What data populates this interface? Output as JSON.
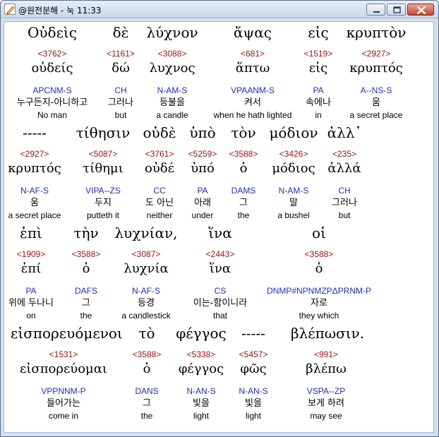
{
  "window": {
    "title": "@원전분해 - 눅 11:33",
    "app_icon": "bible-app-icon",
    "minimize_icon": "minimize-icon",
    "maximize_icon": "maximize-icon",
    "close_icon": "close-icon"
  },
  "colors": {
    "strong": "#9b1111",
    "parse": "#1f2fb8",
    "text": "#000000",
    "selection": "#e9e9e9"
  },
  "words": [
    {
      "greek": "Οὐδεὶς",
      "strong": "<3762>",
      "lemma": "οὐδείς",
      "parse": "APCNM-S",
      "korean": "누구든지-아니하고",
      "english": "No man"
    },
    {
      "greek": "δὲ",
      "strong": "<1161>",
      "lemma": "δώ",
      "parse": "CH",
      "korean": "그러나",
      "english": "but"
    },
    {
      "greek": "λύχνον",
      "strong": "<3088>",
      "lemma": "λυχνος",
      "parse": "N-AM-S",
      "korean": "등불을",
      "english": "a candle"
    },
    {
      "greek": "ἅψας",
      "strong": "<681>",
      "lemma": "ἅπτω",
      "parse": "VPAANM-S",
      "korean": "켜서",
      "english": "when he hath lighted"
    },
    {
      "greek": "εἰς",
      "strong": "<1519>",
      "lemma": "εἰς",
      "parse": "PA",
      "korean": "속에나",
      "english": "in"
    },
    {
      "greek": "κρυπτὸν",
      "strong": "<2927>",
      "lemma": "κρυπτός",
      "parse": "A--NS-S",
      "korean": "움",
      "english": "a secret place"
    },
    {
      "greek": "-----",
      "strong": "<2927>",
      "lemma": "κρυπτός",
      "parse": "N-AF-S",
      "korean": "움",
      "english": "a secret place"
    },
    {
      "greek": "τίθησιν",
      "strong": "<5087>",
      "lemma": "τίθημι",
      "parse": "VIPA--ZS",
      "korean": "두지",
      "english": "putteth it"
    },
    {
      "greek": "οὐδὲ",
      "strong": "<3761>",
      "lemma": "οὐδέ",
      "parse": "CC",
      "korean": "도 아닌",
      "english": "neither"
    },
    {
      "greek": "ὑπὸ",
      "strong": "<5259>",
      "lemma": "ὑπό",
      "parse": "PA",
      "korean": "아래",
      "english": "under"
    },
    {
      "greek": "τὸν",
      "strong": "<3588>",
      "lemma": "ὁ",
      "parse": "DAMS",
      "korean": "그",
      "english": "the"
    },
    {
      "greek": "μόδιον",
      "strong": "<3426>",
      "lemma": "μόδιος",
      "parse": "N-AM-S",
      "korean": "말",
      "english": "a bushel"
    },
    {
      "greek": "ἀλλ᾽",
      "strong": "<235>",
      "lemma": "ἀλλά",
      "parse": "CH",
      "korean": "그러나",
      "english": "but"
    },
    {
      "greek": "ἐπὶ",
      "strong": "<1909>",
      "lemma": "ἐπί",
      "parse": "PA",
      "korean": "위에 두나니",
      "english": "on"
    },
    {
      "greek": "τὴν",
      "strong": "<3588>",
      "lemma": "ὁ",
      "parse": "DAFS",
      "korean": "그",
      "english": "the"
    },
    {
      "greek": "λυχνίαν,",
      "strong": "<3087>",
      "lemma": "λυχνία",
      "parse": "N-AF-S",
      "korean": "등경",
      "english": "a candlestick"
    },
    {
      "greek": "ἵνα",
      "strong": "<2443>",
      "lemma": "ἵνα",
      "parse": "CS",
      "korean": "이는-함이니라",
      "english": "that"
    },
    {
      "greek": "οἱ",
      "strong": "<3588>",
      "lemma": "ὁ",
      "parse": "DNMP#NPNMZPΔPRNM-P",
      "korean": "자로",
      "english": "they which"
    },
    {
      "greek": "εἰσπορευόμενοι",
      "strong": "<1531>",
      "lemma": "εἰσπορεύομαι",
      "parse": "VPPNNM-P",
      "korean": "들어가는",
      "english": "come in"
    },
    {
      "greek": "τὸ",
      "strong": "<3588>",
      "lemma": "ὁ",
      "parse": "DANS",
      "korean": "그",
      "english": "the"
    },
    {
      "greek": "φέγγος",
      "strong": "<5338>",
      "lemma": "φέγγος",
      "parse": "N-AN-S",
      "korean": "빛을",
      "english": "light"
    },
    {
      "greek": "-----",
      "strong": "<5457>",
      "lemma": "φῶς",
      "parse": "N-AN-S",
      "korean": "빛을",
      "english": "light"
    },
    {
      "greek": "βλέπωσιν.",
      "strong": "<991>",
      "lemma": "βλέπω",
      "parse": "VSPA--ZP",
      "korean": "보게 하려",
      "english": "may see"
    }
  ]
}
